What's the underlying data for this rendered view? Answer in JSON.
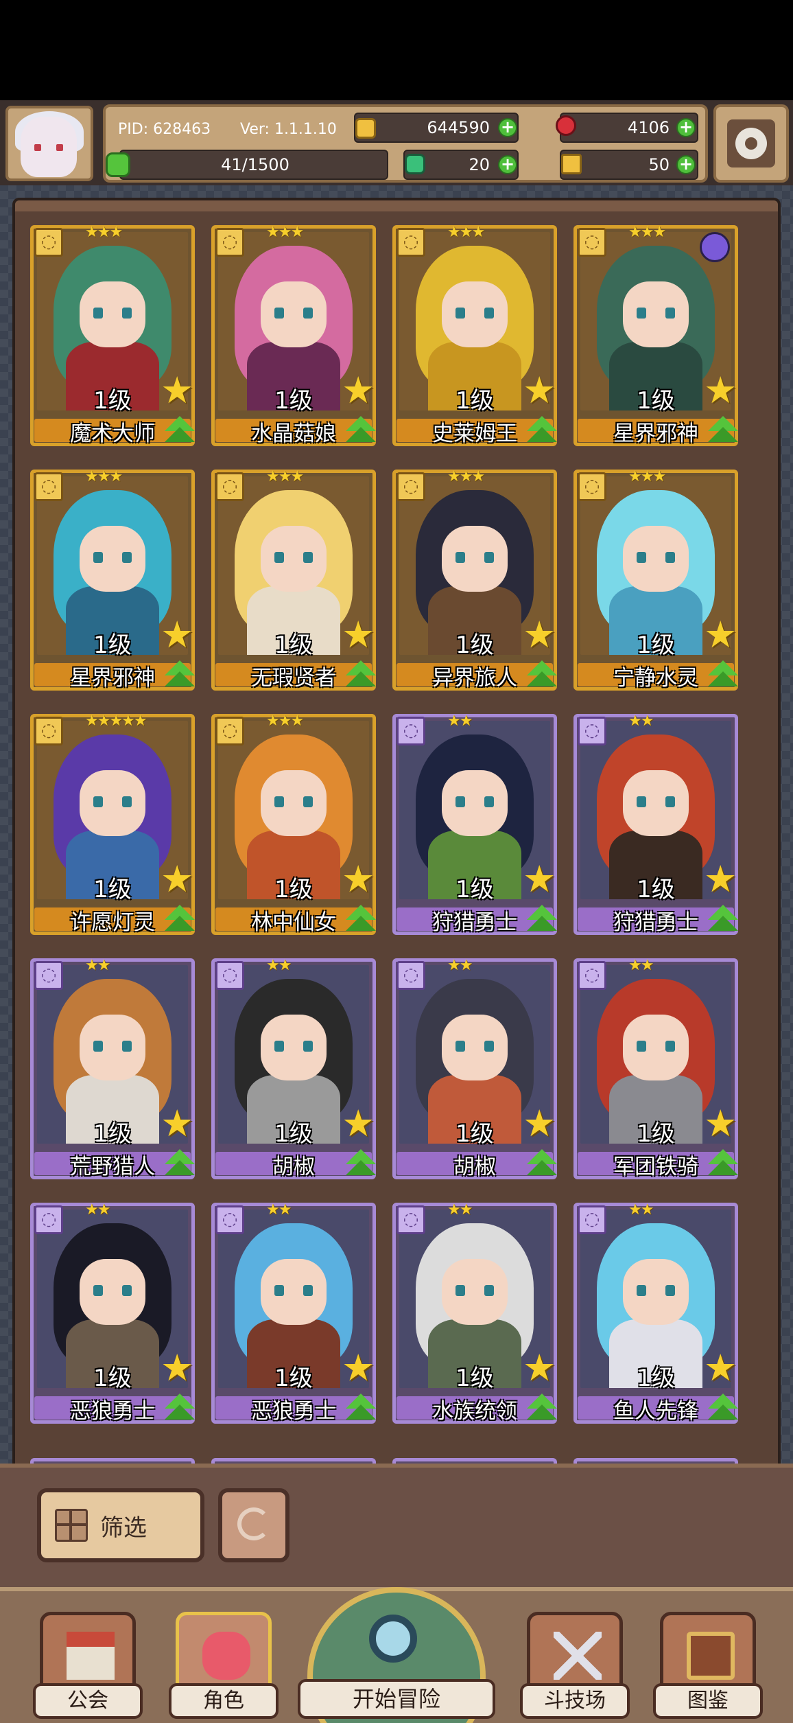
{
  "header": {
    "pid": "PID: 628463",
    "version": "Ver: 1.1.1.10",
    "gold": "644590",
    "gems": "4106",
    "energy": "41/1500",
    "clover": "20",
    "puzzle": "50"
  },
  "cards": [
    {
      "level": "1级",
      "name": "魔术大师",
      "frame": "gold",
      "rarity": "★★★",
      "hair": "#3f8a6c",
      "body": "#9b2a2e"
    },
    {
      "level": "1级",
      "name": "水晶菇娘",
      "frame": "gold",
      "rarity": "★★★",
      "hair": "#d46ba0",
      "body": "#6a2a54"
    },
    {
      "level": "1级",
      "name": "史莱姆王",
      "frame": "gold",
      "rarity": "★★★",
      "hair": "#e0b830",
      "body": "#c89620"
    },
    {
      "level": "1级",
      "name": "星界邪神",
      "frame": "gold",
      "rarity": "★★★",
      "hair": "#3a6a58",
      "body": "#2a4a40"
    },
    {
      "level": "1级",
      "name": "星界邪神",
      "frame": "gold",
      "rarity": "★★★",
      "hair": "#3ab0c8",
      "body": "#2a6a8a"
    },
    {
      "level": "1级",
      "name": "无瑕贤者",
      "frame": "gold",
      "rarity": "★★★",
      "hair": "#f0d070",
      "body": "#e8dcc8"
    },
    {
      "level": "1级",
      "name": "异界旅人",
      "frame": "gold",
      "rarity": "★★★",
      "hair": "#2a2a3a",
      "body": "#6a4a30"
    },
    {
      "level": "1级",
      "name": "宁静水灵",
      "frame": "gold",
      "rarity": "★★★",
      "hair": "#7ad8e8",
      "body": "#4aa0c0"
    },
    {
      "level": "1级",
      "name": "许愿灯灵",
      "frame": "gold",
      "rarity": "★★★★★",
      "hair": "#5a3aa8",
      "body": "#3a6aa8"
    },
    {
      "level": "1级",
      "name": "林中仙女",
      "frame": "gold",
      "rarity": "★★★",
      "hair": "#e08a30",
      "body": "#c0542a"
    },
    {
      "level": "1级",
      "name": "狩猎勇士",
      "frame": "purple",
      "rarity": "★★",
      "hair": "#1e2440",
      "body": "#5a8a3a"
    },
    {
      "level": "1级",
      "name": "狩猎勇士",
      "frame": "purple",
      "rarity": "★★",
      "hair": "#c0442a",
      "body": "#3a2a22"
    },
    {
      "level": "1级",
      "name": "荒野猎人",
      "frame": "purple",
      "rarity": "★★",
      "hair": "#c07a3a",
      "body": "#ded8d0"
    },
    {
      "level": "1级",
      "name": "胡椒",
      "frame": "purple",
      "rarity": "★★",
      "hair": "#2a2a2a",
      "body": "#9a9a9a"
    },
    {
      "level": "1级",
      "name": "胡椒",
      "frame": "purple",
      "rarity": "★★",
      "hair": "#3a3a4a",
      "body": "#c05a3a"
    },
    {
      "level": "1级",
      "name": "军团铁骑",
      "frame": "purple",
      "rarity": "★★",
      "hair": "#b83a2a",
      "body": "#8a8a90"
    },
    {
      "level": "1级",
      "name": "恶狼勇士",
      "frame": "purple",
      "rarity": "★★",
      "hair": "#1a1a26",
      "body": "#6a5a4a"
    },
    {
      "level": "1级",
      "name": "恶狼勇士",
      "frame": "purple",
      "rarity": "★★",
      "hair": "#5ab0e0",
      "body": "#7a3a2a"
    },
    {
      "level": "1级",
      "name": "水族统领",
      "frame": "purple",
      "rarity": "★★",
      "hair": "#dcdcdc",
      "body": "#5a6a50"
    },
    {
      "level": "1级",
      "name": "鱼人先锋",
      "frame": "purple",
      "rarity": "★★",
      "hair": "#6acae8",
      "body": "#e0e0e8"
    }
  ],
  "toolbar": {
    "filter_label": "筛选"
  },
  "nav": {
    "guild": "公会",
    "character": "角色",
    "start": "开始冒险",
    "arena": "斗技场",
    "codex": "图鉴"
  }
}
